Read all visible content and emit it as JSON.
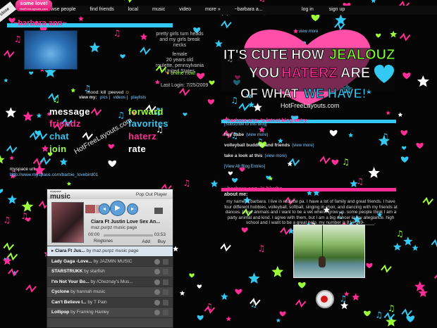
{
  "promo": {
    "text": "some love!",
    "sub": "HotFreeLayouts.com"
  },
  "corner_label": "close",
  "nav": {
    "links": [
      "browse people",
      "find friends",
      "local",
      "music",
      "video",
      "more »",
      "~barbara a..."
    ],
    "auth": [
      "log in",
      "sign up"
    ]
  },
  "profile": {
    "name": "~barbara ann~",
    "headline_lines": [
      "pretty girls turn heads",
      "and my girls break",
      "necks"
    ],
    "details": [
      "female",
      "20 years old",
      "roulette, pennsylvania",
      "United States"
    ],
    "online": "online now!",
    "last_login": "Last Login: 7/25/2009",
    "mood": "mood: kill :peeved",
    "view_my_label": "view my:",
    "view_my_links": [
      "pics",
      "videos",
      "playlists"
    ]
  },
  "contact": [
    {
      "label": "message",
      "color": "#ffffff"
    },
    {
      "label": "forward",
      "color": "#9cff3a"
    },
    {
      "label": "friendz",
      "color": "#ff2d95"
    },
    {
      "label": "favorites",
      "color": "#33c9f2"
    },
    {
      "label": "chat",
      "color": "#33c9f2"
    },
    {
      "label": "haterz",
      "color": "#ff2d95"
    },
    {
      "label": "join",
      "color": "#9cff3a"
    },
    {
      "label": "rate",
      "color": "#ffffff"
    }
  ],
  "watermark": "HotFreeLayouts.com",
  "myspace_url": {
    "label": "myspace url:",
    "url": "http://www.myspace.com/barbie_lovebird01"
  },
  "player": {
    "brand": "music",
    "brand_sub": "myspace",
    "popout": "Pop Out Player",
    "now_title": "Ciara Ft Justin Love Sex An...",
    "now_sub": "maz.purpz music page",
    "time_start": "00:00",
    "time_end": "03:53",
    "ringtones": "Ringtones",
    "add": "Add",
    "buy": "Buy",
    "tracks": [
      {
        "title": "Ciara Ft Jus...",
        "by": "by maz.purpz music page"
      },
      {
        "title": "Lady Gaga -Love...",
        "by": "by JAZMIN MUSIC"
      },
      {
        "title": "STARSTRUKK",
        "by": "by starfish"
      },
      {
        "title": "I'm Not Your Bo...",
        "by": "by /Cheznay's Mus..."
      },
      {
        "title": "Cyclone",
        "by": "by hannah music"
      },
      {
        "title": "Can't Believe I...",
        "by": "by T Pain"
      },
      {
        "title": "Lollipop",
        "by": "by Framing Hanley"
      }
    ]
  },
  "banner": {
    "line1a": "IT'S CUTE HOW",
    "line1b": "JEALOUZ",
    "line2a": "YOU",
    "line2b": "HATERZ",
    "line2c": "ARE",
    "line3a": "OF WHAT",
    "line3b": "WE HAVE!",
    "view_more": "view more",
    "watermark": "HotFreeLayouts.com"
  },
  "blog": {
    "title": "~barbara ann~'s latest blog entry",
    "subscribe": "[Subscribe to this blog]",
    "entries": [
      {
        "text": "hey babe",
        "link": "(view more)"
      },
      {
        "text": "volleyball buddies and friends",
        "link": "(view more)"
      },
      {
        "text": "take a look at this",
        "link": "(view more)"
      }
    ],
    "view_all": "[View All Blog Entries]"
  },
  "blurbs": {
    "title": "~barbara ann~'s blurbs",
    "about_heading": "about me:",
    "about_text": "my name is barbara. I live in roulette pa. I have a lot of family and great friends. I have four different hobbies, volleyball, softball, singing in choir, and dancing with my friends at dances. I love animals and I want to be a vet when I grow up. some people think I am a party animal and kind. I agree with them, but I am a big dancer in my allegiance. high school and I want to be a great help. my number is 814-339-____."
  }
}
